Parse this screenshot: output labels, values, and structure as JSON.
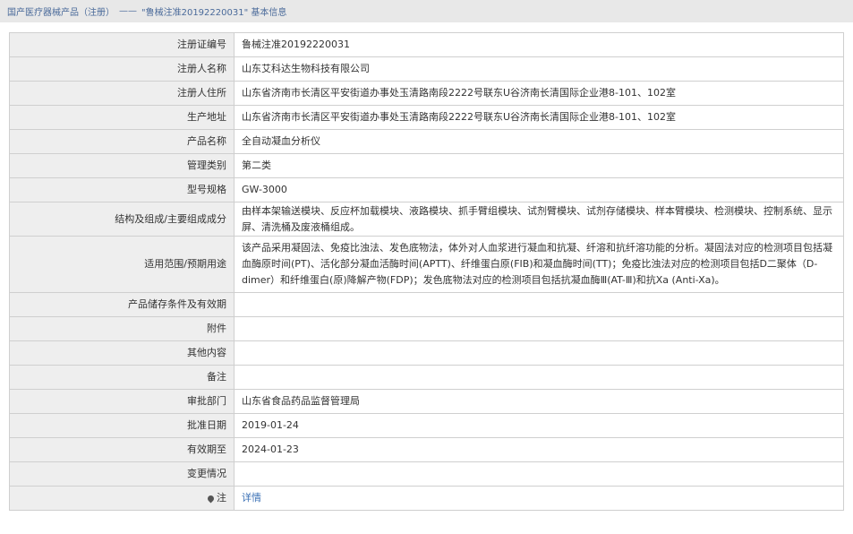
{
  "breadcrumb": {
    "root": "国产医疗器械产品（注册）",
    "separator": "——",
    "current": "\"鲁械注准20192220031\" 基本信息"
  },
  "rows": [
    {
      "label": "注册证编号",
      "value": "鲁械注准20192220031"
    },
    {
      "label": "注册人名称",
      "value": "山东艾科达生物科技有限公司"
    },
    {
      "label": "注册人住所",
      "value": "山东省济南市长清区平安街道办事处玉清路南段2222号联东U谷济南长清国际企业港8-101、102室"
    },
    {
      "label": "生产地址",
      "value": "山东省济南市长清区平安街道办事处玉清路南段2222号联东U谷济南长清国际企业港8-101、102室"
    },
    {
      "label": "产品名称",
      "value": "全自动凝血分析仪"
    },
    {
      "label": "管理类别",
      "value": "第二类"
    },
    {
      "label": "型号规格",
      "value": "GW-3000"
    },
    {
      "label": "结构及组成/主要组成成分",
      "value": "由样本架输送模块、反应杯加载模块、液路模块、抓手臂组模块、试剂臂模块、试剂存储模块、样本臂模块、检测模块、控制系统、显示屏、清洗桶及废液桶组成。"
    },
    {
      "label": "适用范围/预期用途",
      "value": "该产品采用凝固法、免疫比浊法、发色底物法，体外对人血浆进行凝血和抗凝、纤溶和抗纤溶功能的分析。凝固法对应的检测项目包括凝血酶原时间(PT)、活化部分凝血活酶时间(APTT)、纤维蛋白原(FIB)和凝血酶时间(TT)；免疫比浊法对应的检测项目包括D二聚体（D-dimer）和纤维蛋白(原)降解产物(FDP)；发色底物法对应的检测项目包括抗凝血酶Ⅲ(AT-Ⅲ)和抗Xa (Anti-Xa)。"
    },
    {
      "label": "产品储存条件及有效期",
      "value": ""
    },
    {
      "label": "附件",
      "value": ""
    },
    {
      "label": "其他内容",
      "value": ""
    },
    {
      "label": "备注",
      "value": ""
    },
    {
      "label": "审批部门",
      "value": "山东省食品药品监督管理局"
    },
    {
      "label": "批准日期",
      "value": "2019-01-24"
    },
    {
      "label": "有效期至",
      "value": "2024-01-23"
    },
    {
      "label": "变更情况",
      "value": ""
    }
  ],
  "note_row": {
    "label": "注",
    "link": "详情"
  },
  "colors": {
    "label_bg": "#eeeeee",
    "border": "#cfcfcf",
    "link": "#3a70b5",
    "topbar_bg": "#e8e8e8"
  }
}
